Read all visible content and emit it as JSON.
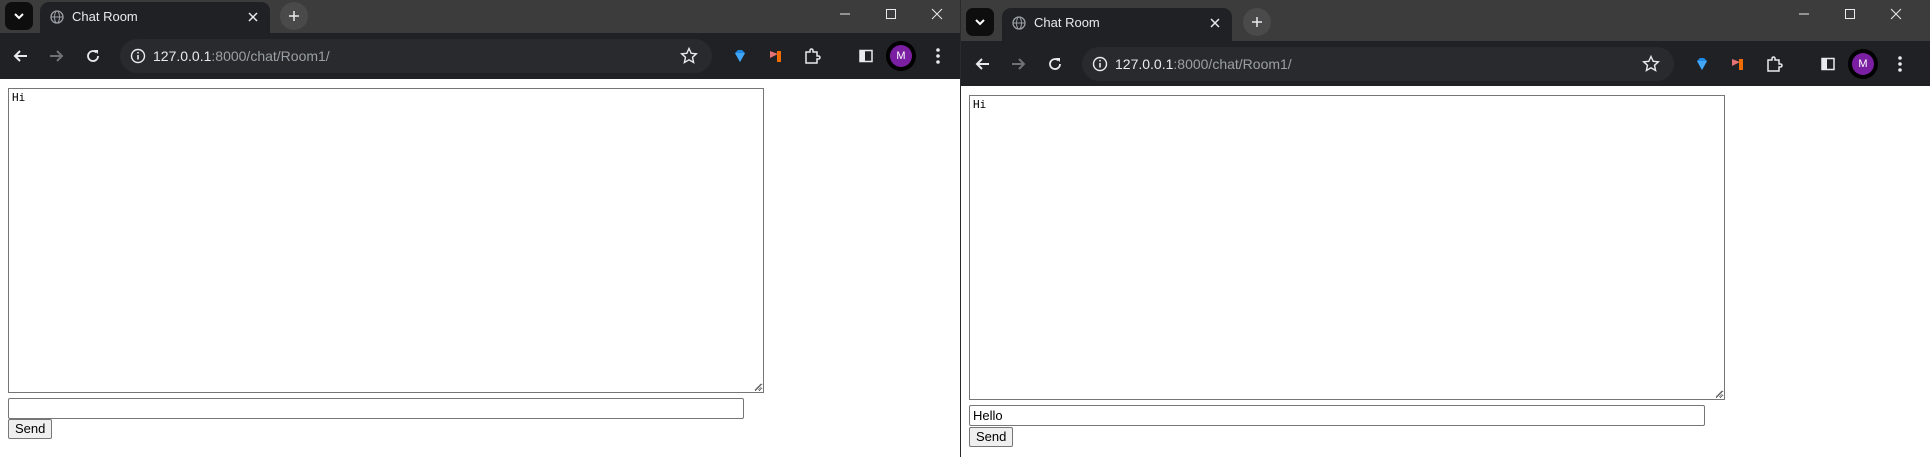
{
  "windows": [
    {
      "tab": {
        "title": "Chat Room"
      },
      "address": {
        "host": "127.0.0.1",
        "path": ":8000/chat/Room1/"
      },
      "chat": {
        "log_text": "Hi",
        "input_value": "",
        "send_label": "Send"
      },
      "profile": {
        "initial": "M"
      }
    },
    {
      "tab": {
        "title": "Chat Room"
      },
      "address": {
        "host": "127.0.0.1",
        "path": ":8000/chat/Room1/"
      },
      "chat": {
        "log_text": "Hi",
        "input_value": "Hello",
        "send_label": "Send"
      },
      "profile": {
        "initial": "M"
      }
    }
  ],
  "colors": {
    "tabstrip": "#3c3c3c",
    "toolbar": "#202124",
    "avatar": "#7a1fa2"
  },
  "icons": [
    "chevron-down-icon",
    "globe-icon",
    "close-icon",
    "plus-icon",
    "minimize-icon",
    "maximize-icon",
    "back-arrow-icon",
    "forward-arrow-icon",
    "reload-icon",
    "info-icon",
    "star-icon",
    "gem-extension-icon",
    "flag-extension-icon",
    "puzzle-extensions-icon",
    "side-panel-icon",
    "kebab-menu-icon"
  ]
}
